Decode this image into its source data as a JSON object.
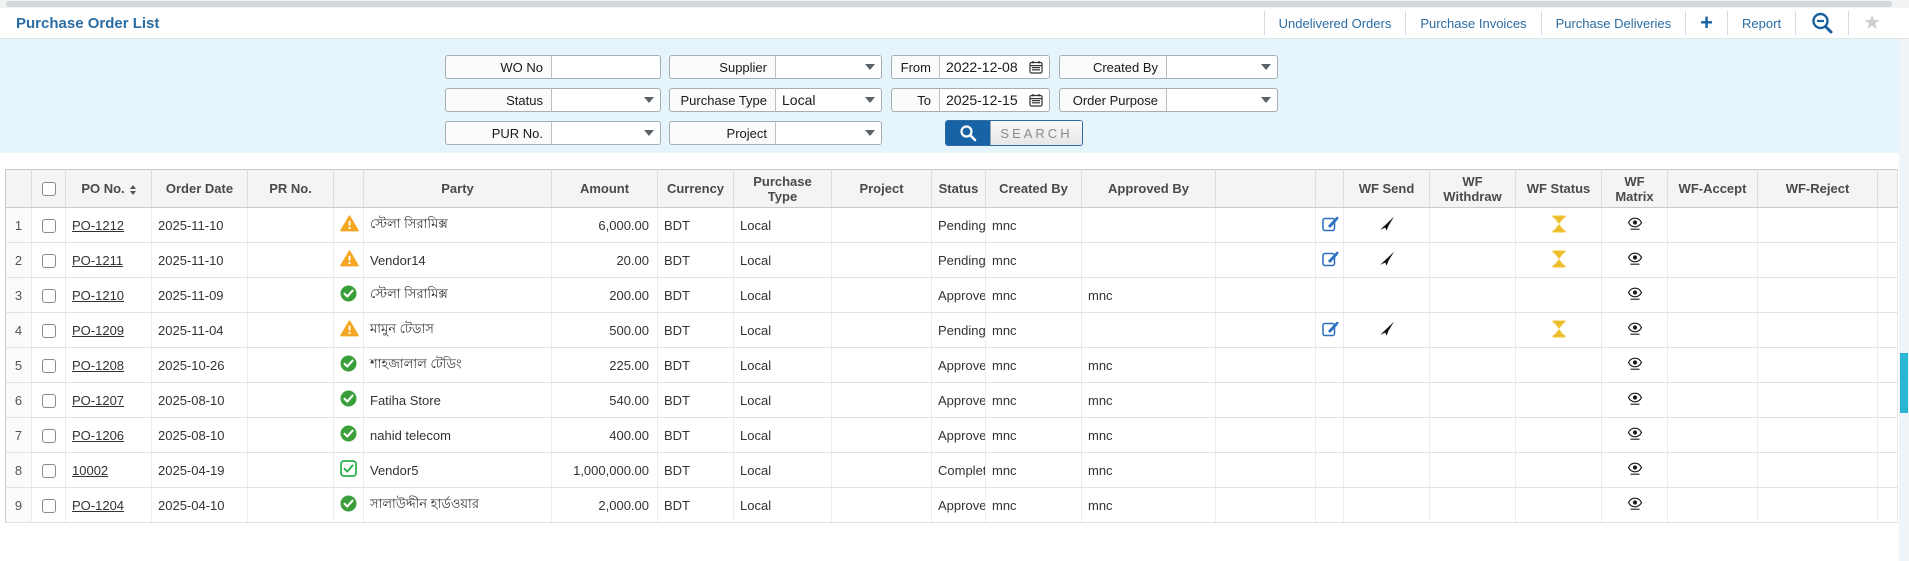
{
  "page": {
    "title": "Purchase Order List"
  },
  "toolbar": {
    "links": [
      {
        "label": "Undelivered Orders"
      },
      {
        "label": "Purchase Invoices"
      },
      {
        "label": "Purchase Deliveries"
      }
    ],
    "plus_label": "+",
    "report_label": "Report",
    "icons": [
      "add-plus-icon",
      "zoom-out-icon",
      "favorite-star-icon"
    ]
  },
  "filters": {
    "wo_no": {
      "label": "WO No",
      "value": ""
    },
    "supplier": {
      "label": "Supplier",
      "value": ""
    },
    "from": {
      "label": "From",
      "value": "2022-12-08"
    },
    "created_by": {
      "label": "Created By",
      "value": ""
    },
    "status": {
      "label": "Status",
      "value": ""
    },
    "purchase_type": {
      "label": "Purchase Type",
      "value": "Local"
    },
    "to": {
      "label": "To",
      "value": "2025-12-15"
    },
    "order_purpose": {
      "label": "Order Purpose",
      "value": ""
    },
    "pur_no": {
      "label": "PUR No.",
      "value": ""
    },
    "project": {
      "label": "Project",
      "value": ""
    },
    "search_label": "SEARCH"
  },
  "table": {
    "columns": [
      "",
      "",
      "PO No.",
      "Order Date",
      "PR No.",
      "",
      "Party",
      "Amount",
      "Currency",
      "Purchase Type",
      "Project",
      "Status",
      "Created By",
      "Approved By",
      "",
      "",
      "WF Send",
      "WF Withdraw",
      "WF Status",
      "WF Matrix",
      "WF-Accept",
      "WF-Reject",
      ""
    ],
    "rows": [
      {
        "num": "1",
        "po_no": "PO-1212",
        "order_date": "2025-11-10",
        "pr_no": "",
        "party_status": "warning",
        "party": "স্টেলা সিরামিক্স",
        "amount": "6,000.00",
        "currency": "BDT",
        "purchase_type": "Local",
        "project": "",
        "status": "Pending",
        "created_by": "mnc",
        "approved_by": "",
        "actions": {
          "edit": true,
          "send": true,
          "hourglass": true,
          "eye": true
        }
      },
      {
        "num": "2",
        "po_no": "PO-1211",
        "order_date": "2025-11-10",
        "pr_no": "",
        "party_status": "warning",
        "party": "Vendor14",
        "amount": "20.00",
        "currency": "BDT",
        "purchase_type": "Local",
        "project": "",
        "status": "Pending",
        "created_by": "mnc",
        "approved_by": "",
        "actions": {
          "edit": true,
          "send": true,
          "hourglass": true,
          "eye": true
        }
      },
      {
        "num": "3",
        "po_no": "PO-1210",
        "order_date": "2025-11-09",
        "pr_no": "",
        "party_status": "approved",
        "party": "স্টেলা সিরামিক্স",
        "amount": "200.00",
        "currency": "BDT",
        "purchase_type": "Local",
        "project": "",
        "status": "Approved",
        "created_by": "mnc",
        "approved_by": "mnc",
        "actions": {
          "edit": false,
          "send": false,
          "hourglass": false,
          "eye": true
        }
      },
      {
        "num": "4",
        "po_no": "PO-1209",
        "order_date": "2025-11-04",
        "pr_no": "",
        "party_status": "warning",
        "party": "মামুন টেডাস",
        "amount": "500.00",
        "currency": "BDT",
        "purchase_type": "Local",
        "project": "",
        "status": "Pending",
        "created_by": "mnc",
        "approved_by": "",
        "actions": {
          "edit": true,
          "send": true,
          "hourglass": true,
          "eye": true
        }
      },
      {
        "num": "5",
        "po_no": "PO-1208",
        "order_date": "2025-10-26",
        "pr_no": "",
        "party_status": "approved",
        "party": "শাহজালাল টেডিং",
        "amount": "225.00",
        "currency": "BDT",
        "purchase_type": "Local",
        "project": "",
        "status": "Approved",
        "created_by": "mnc",
        "approved_by": "mnc",
        "actions": {
          "edit": false,
          "send": false,
          "hourglass": false,
          "eye": true
        }
      },
      {
        "num": "6",
        "po_no": "PO-1207",
        "order_date": "2025-08-10",
        "pr_no": "",
        "party_status": "approved",
        "party": "Fatiha Store",
        "amount": "540.00",
        "currency": "BDT",
        "purchase_type": "Local",
        "project": "",
        "status": "Approved",
        "created_by": "mnc",
        "approved_by": "mnc",
        "actions": {
          "edit": false,
          "send": false,
          "hourglass": false,
          "eye": true
        }
      },
      {
        "num": "7",
        "po_no": "PO-1206",
        "order_date": "2025-08-10",
        "pr_no": "",
        "party_status": "approved",
        "party": "nahid telecom",
        "amount": "400.00",
        "currency": "BDT",
        "purchase_type": "Local",
        "project": "",
        "status": "Approved",
        "created_by": "mnc",
        "approved_by": "mnc",
        "actions": {
          "edit": false,
          "send": false,
          "hourglass": false,
          "eye": true
        }
      },
      {
        "num": "8",
        "po_no": "10002",
        "order_date": "2025-04-19",
        "pr_no": "",
        "party_status": "complete",
        "party": "Vendor5",
        "amount": "1,000,000.00",
        "currency": "BDT",
        "purchase_type": "Local",
        "project": "",
        "status": "Complete",
        "created_by": "mnc",
        "approved_by": "mnc",
        "actions": {
          "edit": false,
          "send": false,
          "hourglass": false,
          "eye": true
        }
      },
      {
        "num": "9",
        "po_no": "PO-1204",
        "order_date": "2025-04-10",
        "pr_no": "",
        "party_status": "approved",
        "party": "সালাউদ্দীন হার্ডওয়ার",
        "amount": "2,000.00",
        "currency": "BDT",
        "purchase_type": "Local",
        "project": "",
        "status": "Approved",
        "created_by": "mnc",
        "approved_by": "mnc",
        "actions": {
          "edit": false,
          "send": false,
          "hourglass": false,
          "eye": true
        }
      }
    ]
  },
  "colors": {
    "accent_blue": "#2b6ca3",
    "filter_panel_bg": "#e6f4fb",
    "search_button_blue": "#1763a6",
    "warning_orange": "#f5a623",
    "approved_green": "#3a9e3a",
    "complete_green": "#2eb050",
    "hourglass_yellow": "#f1c232",
    "edit_icon_blue": "#2a6fc0",
    "scrollbar_thumb_cyan": "#2ab5d5"
  }
}
